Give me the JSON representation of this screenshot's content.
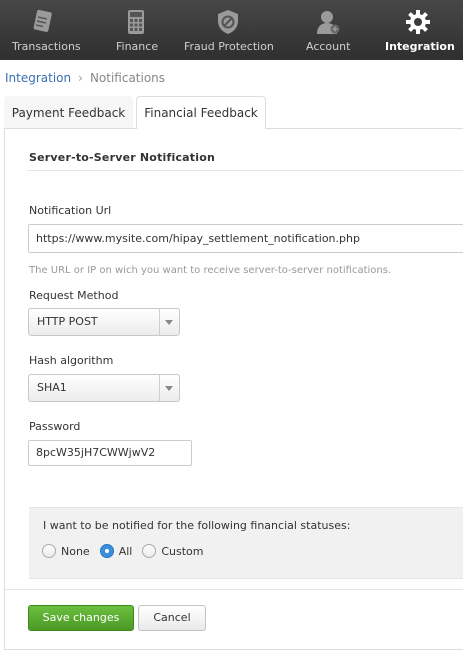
{
  "nav": {
    "items": [
      {
        "label": "Transactions",
        "icon": "receipt-icon",
        "active": false
      },
      {
        "label": "Finance",
        "icon": "calculator-icon",
        "active": false
      },
      {
        "label": "Fraud Protection",
        "icon": "shield-block-icon",
        "active": false
      },
      {
        "label": "Account",
        "icon": "user-icon",
        "active": false
      },
      {
        "label": "Integration",
        "icon": "gear-icon",
        "active": true
      }
    ]
  },
  "breadcrumb": {
    "root": "Integration",
    "separator": "›",
    "current": "Notifications"
  },
  "tabs": [
    {
      "label": "Payment Feedback",
      "active": false
    },
    {
      "label": "Financial Feedback",
      "active": true
    }
  ],
  "form": {
    "section_title": "Server-to-Server Notification",
    "url_label": "Notification Url",
    "url_value": "https://www.mysite.com/hipay_settlement_notification.php",
    "url_help": "The URL or IP on wich you want to receive server-to-server notifications.",
    "method_label": "Request Method",
    "method_value": "HTTP POST",
    "hash_label": "Hash algorithm",
    "hash_value": "SHA1",
    "password_label": "Password",
    "password_value": "8pcW35jH7CWWjwV2"
  },
  "statuses": {
    "label": "I want to be notified for the following financial statuses:",
    "options": [
      {
        "label": "None",
        "checked": false
      },
      {
        "label": "All",
        "checked": true
      },
      {
        "label": "Custom",
        "checked": false
      }
    ]
  },
  "buttons": {
    "save": "Save changes",
    "cancel": "Cancel"
  },
  "colors": {
    "nav_bg": "#3b3b3b",
    "accent_green": "#5aac31",
    "link_blue": "#3a6fb0",
    "radio_blue": "#3b8fde"
  }
}
